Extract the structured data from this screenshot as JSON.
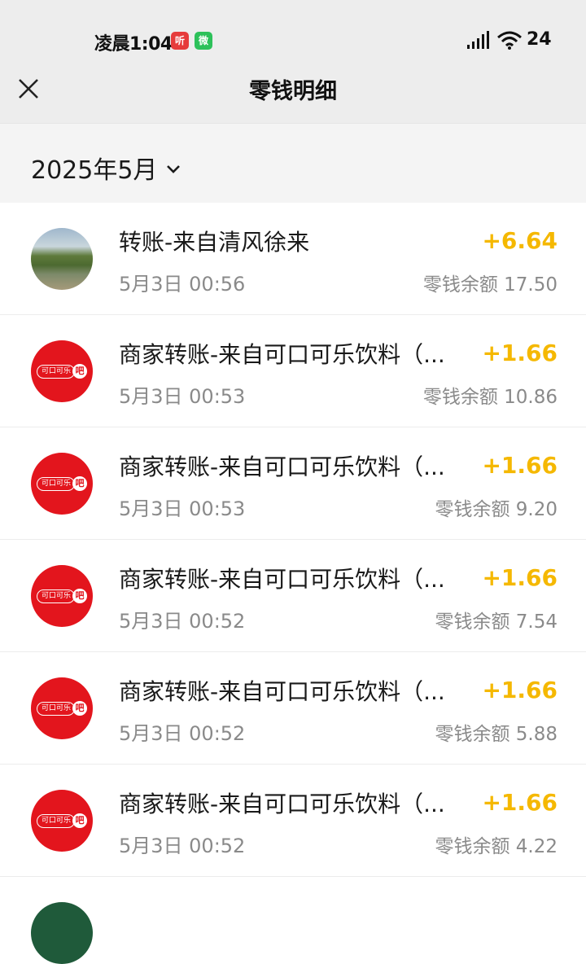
{
  "status_bar": {
    "time": "凌晨1:04",
    "app_icon_1": "听",
    "app_icon_2": "微",
    "battery": "24",
    "signal_icon": "signal-icon",
    "wifi_icon": "wifi-icon"
  },
  "header": {
    "title": "零钱明细",
    "close_icon": "close-icon"
  },
  "filter": {
    "month": "2025年5月"
  },
  "transactions": [
    {
      "name": "转账-来自清风徐来",
      "date": "5月3日 00:56",
      "amount": "+6.64",
      "balance": "零钱余额 17.50",
      "avatar": "photo"
    },
    {
      "name": "商家转账-来自可口可乐饮料（...",
      "date": "5月3日 00:53",
      "amount": "+1.66",
      "balance": "零钱余额 10.86",
      "avatar": "brand"
    },
    {
      "name": "商家转账-来自可口可乐饮料（...",
      "date": "5月3日 00:53",
      "amount": "+1.66",
      "balance": "零钱余额 9.20",
      "avatar": "brand"
    },
    {
      "name": "商家转账-来自可口可乐饮料（...",
      "date": "5月3日 00:52",
      "amount": "+1.66",
      "balance": "零钱余额 7.54",
      "avatar": "brand"
    },
    {
      "name": "商家转账-来自可口可乐饮料（...",
      "date": "5月3日 00:52",
      "amount": "+1.66",
      "balance": "零钱余额 5.88",
      "avatar": "brand"
    },
    {
      "name": "商家转账-来自可口可乐饮料（...",
      "date": "5月3日 00:52",
      "amount": "+1.66",
      "balance": "零钱余额 4.22",
      "avatar": "brand"
    }
  ],
  "brand_logo": {
    "text": "可口可乐",
    "bubble": "吧"
  },
  "colors": {
    "amount": "#f5b800",
    "brand_red": "#e3151d",
    "header_bg": "#ededed"
  }
}
